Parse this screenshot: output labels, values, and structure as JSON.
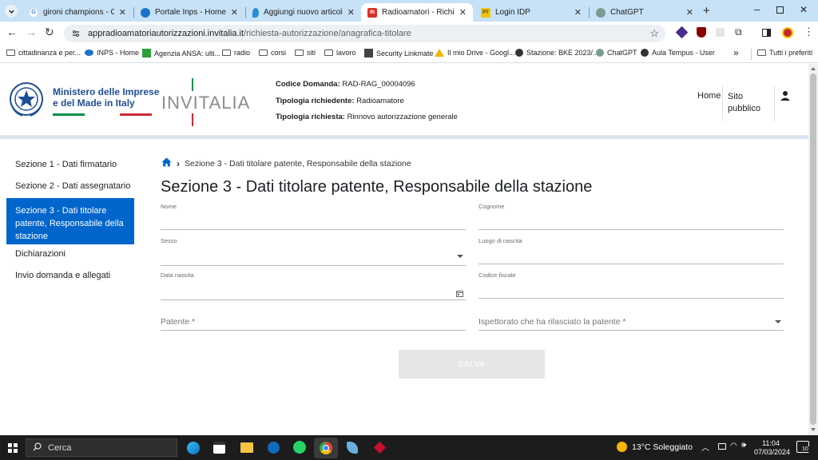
{
  "browser": {
    "tabs": [
      {
        "title": "gironi champions - Cerca c",
        "fav_color": "#4285f4",
        "fav_text": "G"
      },
      {
        "title": "Portale Inps - Home",
        "fav_color": "#1a73c8",
        "fav_text": ""
      },
      {
        "title": "Aggiungi nuovo articolo «",
        "fav_color": "#2a8ad8",
        "fav_text": ""
      },
      {
        "title": "Radioamatori - Richiesta A",
        "fav_color": "#d93025",
        "fav_text": "IN"
      },
      {
        "title": "Login IDP",
        "fav_color": "#f2c200",
        "fav_text": "PT"
      },
      {
        "title": "ChatGPT",
        "fav_color": "#7a9b94",
        "fav_text": ""
      }
    ],
    "url_domain": "appradioamatoriautorizzazioni.invitalia.it",
    "url_path": "/richiesta-autorizzazione/anagrafica-titolare",
    "bookmarks": [
      "cittadinanza e per...",
      "INPS - Home",
      "Agenzia ANSA: ulti...",
      "radio",
      "corsi",
      "siti",
      "lavoro",
      "Security Linkmate",
      "Il mio Drive - Googl...",
      "Stazione: BKE 2023/...",
      "ChatGPT",
      "Aula Tempus - User"
    ],
    "bookmarks_more": "»",
    "all_bookmarks": "Tutti i preferiti"
  },
  "header": {
    "ministry_line1": "Ministero delle Imprese",
    "ministry_line2": "e del Made in Italy",
    "brand": "INVITALIA",
    "codice_label": "Codice Domanda:",
    "codice_value": "RAD-RAG_00004096",
    "tipologia_richiedente_label": "Tipologia richiedente:",
    "tipologia_richiedente_value": "Radioamatore",
    "tipologia_richiesta_label": "Tipologia richiesta:",
    "tipologia_richiesta_value": "Rinnovo autorizzazione generale",
    "nav_home": "Home",
    "nav_sito_line1": "Sito",
    "nav_sito_line2": "pubblico"
  },
  "sidebar": {
    "items": [
      {
        "label": "Sezione 1 - Dati firmatario",
        "active": false
      },
      {
        "label": "Sezione 2 - Dati assegnatario",
        "active": false
      },
      {
        "label": "Sezione 3 - Dati titolare patente, Responsabile della stazione",
        "active": true
      },
      {
        "label": "Dichiarazioni",
        "active": false
      },
      {
        "label": "Invio domanda e allegati",
        "active": false
      }
    ]
  },
  "main": {
    "breadcrumb": "Sezione 3 - Dati titolare patente, Responsabile della stazione",
    "title": "Sezione 3 - Dati titolare patente, Responsabile della stazione",
    "fields": {
      "nome": "Nome",
      "cognome": "Cognome",
      "sesso": "Sesso",
      "luogo_nascita": "Luogo di nascita",
      "data_nascita": "Data nascita",
      "codice_fiscale": "Codice fiscale",
      "patente": "Patente *",
      "ispettorato": "Ispettorato che ha rilasciato la patente *"
    },
    "save_label": "SALVA"
  },
  "taskbar": {
    "search_placeholder": "Cerca",
    "weather": "13°C  Soleggiato",
    "time": "11:04",
    "date": "07/03/2024",
    "notif_count": "10"
  },
  "colors": {
    "primary": "#0066cc",
    "tabstrip": "#c7e2f7",
    "italy_green": "#009246",
    "italy_red": "#ce2b37"
  }
}
